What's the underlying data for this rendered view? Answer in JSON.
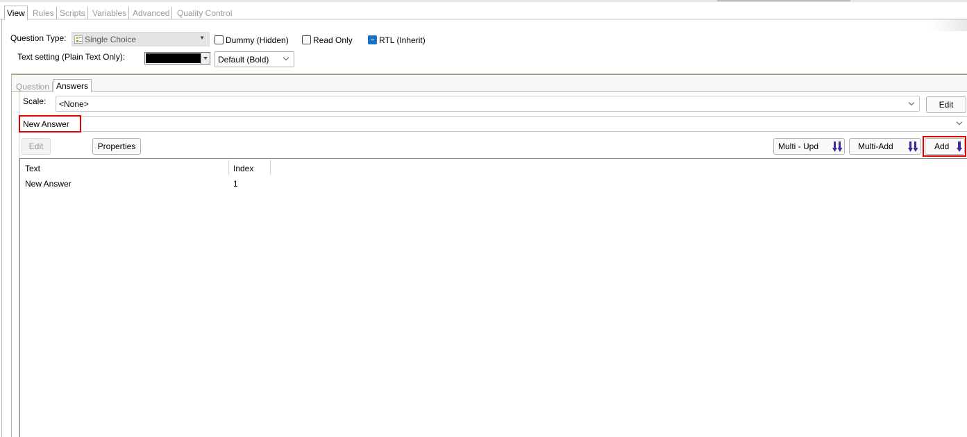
{
  "top_tabs": [
    {
      "label": "View",
      "active": true
    },
    {
      "label": "Rules",
      "active": false
    },
    {
      "label": "Scripts",
      "active": false
    },
    {
      "label": "Variables",
      "active": false
    },
    {
      "label": "Advanced",
      "active": false
    },
    {
      "label": "Quality Control",
      "active": false
    }
  ],
  "question_type": {
    "label": "Question Type:",
    "value": "Single Choice",
    "icon": "single-choice-icon"
  },
  "options": {
    "dummy": {
      "label": "Dummy (Hidden)",
      "checked": false
    },
    "read_only": {
      "label": "Read Only",
      "checked": false
    },
    "rtl": {
      "label": "RTL (Inherit)",
      "checked": true,
      "state": "indeterminate"
    }
  },
  "text_setting": {
    "label": "Text setting (Plain Text Only):",
    "color": "#000000",
    "style_value": "Default (Bold)"
  },
  "inner_tabs": [
    {
      "label": "Question",
      "active": false
    },
    {
      "label": "Answers",
      "active": true
    }
  ],
  "scale": {
    "label": "Scale:",
    "value": "<None>",
    "edit_label": "Edit"
  },
  "answer_selector": {
    "value": "New Answer"
  },
  "toolbar": {
    "edit_label": "Edit",
    "edit_enabled": false,
    "properties_label": "Properties",
    "multi_upd_label": "Multi - Upd",
    "multi_add_label": "Multi-Add",
    "add_label": "Add"
  },
  "answers_table": {
    "columns": [
      "Text",
      "Index"
    ],
    "rows": [
      {
        "text": "New Answer",
        "index": "1"
      }
    ]
  },
  "colors": {
    "highlight": "#e00000",
    "arrow_icon": "#3c2a9a",
    "checkbox_on": "#1a6fc8"
  }
}
